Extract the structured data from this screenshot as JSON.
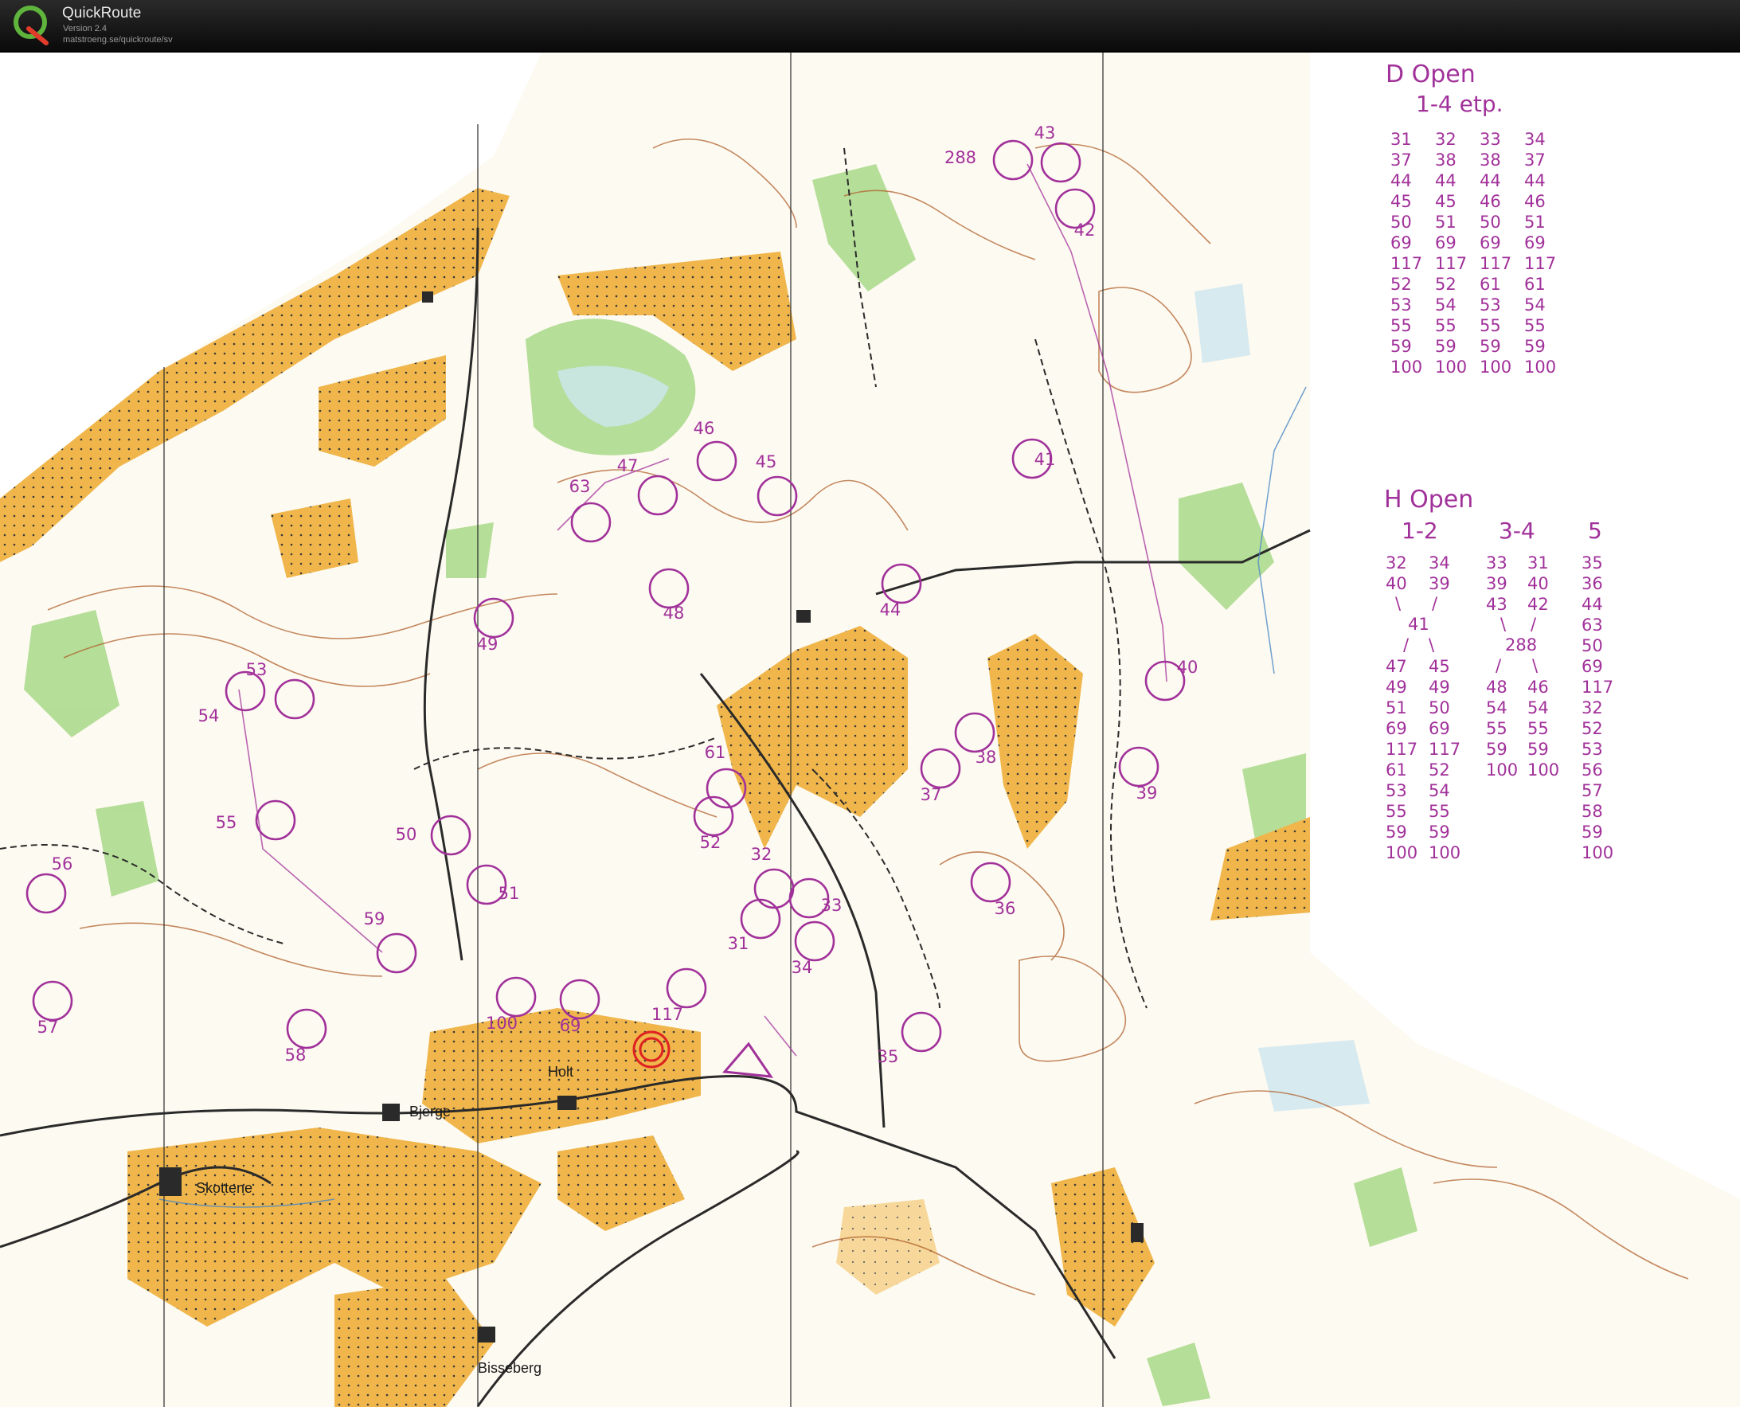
{
  "app": {
    "title": "QuickRoute",
    "version": "Version 2.4",
    "url": "matstroeng.se/quickroute/sv",
    "logo_icon": "quickroute-logo-icon"
  },
  "colors": {
    "course_purple": "#a1319a",
    "open_land": "#f0b64b",
    "forest_green": "#9ad27a",
    "contour_brown": "#b0612e",
    "road_black": "#2a2a2a"
  },
  "places": {
    "holt": "Holt",
    "bjerge": "Bjerge",
    "skottene": "Skottene",
    "bisseberg": "Bisseberg"
  },
  "controls": [
    {
      "label": "288"
    },
    {
      "label": "43"
    },
    {
      "label": "42"
    },
    {
      "label": "41"
    },
    {
      "label": "46"
    },
    {
      "label": "47"
    },
    {
      "label": "45"
    },
    {
      "label": "63"
    },
    {
      "label": "48"
    },
    {
      "label": "44"
    },
    {
      "label": "49"
    },
    {
      "label": "53"
    },
    {
      "label": "54"
    },
    {
      "label": "40"
    },
    {
      "label": "61"
    },
    {
      "label": "38"
    },
    {
      "label": "37"
    },
    {
      "label": "39"
    },
    {
      "label": "55"
    },
    {
      "label": "50"
    },
    {
      "label": "52"
    },
    {
      "label": "56"
    },
    {
      "label": "51"
    },
    {
      "label": "32"
    },
    {
      "label": "33"
    },
    {
      "label": "36"
    },
    {
      "label": "59"
    },
    {
      "label": "31"
    },
    {
      "label": "34"
    },
    {
      "label": "57"
    },
    {
      "label": "100"
    },
    {
      "label": "69"
    },
    {
      "label": "117"
    },
    {
      "label": "58"
    },
    {
      "label": "35"
    }
  ],
  "legend_d": {
    "title": "D Open",
    "subtitle": "1-4 etp.",
    "columns": [
      [
        "31",
        "37",
        "44",
        "45",
        "50",
        "69",
        "117",
        "52",
        "53",
        "55",
        "59",
        "100"
      ],
      [
        "32",
        "38",
        "44",
        "45",
        "51",
        "69",
        "117",
        "52",
        "54",
        "55",
        "59",
        "100"
      ],
      [
        "33",
        "38",
        "44",
        "46",
        "50",
        "69",
        "117",
        "61",
        "53",
        "55",
        "59",
        "100"
      ],
      [
        "34",
        "37",
        "44",
        "46",
        "51",
        "69",
        "117",
        "61",
        "54",
        "55",
        "59",
        "100"
      ]
    ]
  },
  "legend_h": {
    "title": "H Open",
    "group_labels": [
      "1-2",
      "3-4",
      "5"
    ],
    "g12_top": [
      [
        "32",
        "40"
      ],
      [
        "34",
        "39"
      ]
    ],
    "g12_join": "41",
    "g12_bottom": [
      [
        "47",
        "49",
        "51",
        "69",
        "117",
        "61",
        "53",
        "55",
        "59",
        "100"
      ],
      [
        "45",
        "49",
        "50",
        "69",
        "117",
        "52",
        "54",
        "55",
        "59",
        "100"
      ]
    ],
    "g34_top": [
      [
        "33",
        "39",
        "43"
      ],
      [
        "31",
        "40",
        "42"
      ]
    ],
    "g34_join": "288",
    "g34_bottom": [
      [
        "48",
        "54",
        "55",
        "59",
        "100"
      ],
      [
        "46",
        "54",
        "55",
        "59",
        "100"
      ]
    ],
    "g5": [
      "35",
      "36",
      "44",
      "63",
      "50",
      "69",
      "117",
      "32",
      "52",
      "53",
      "56",
      "57",
      "58",
      "59",
      "100"
    ]
  }
}
